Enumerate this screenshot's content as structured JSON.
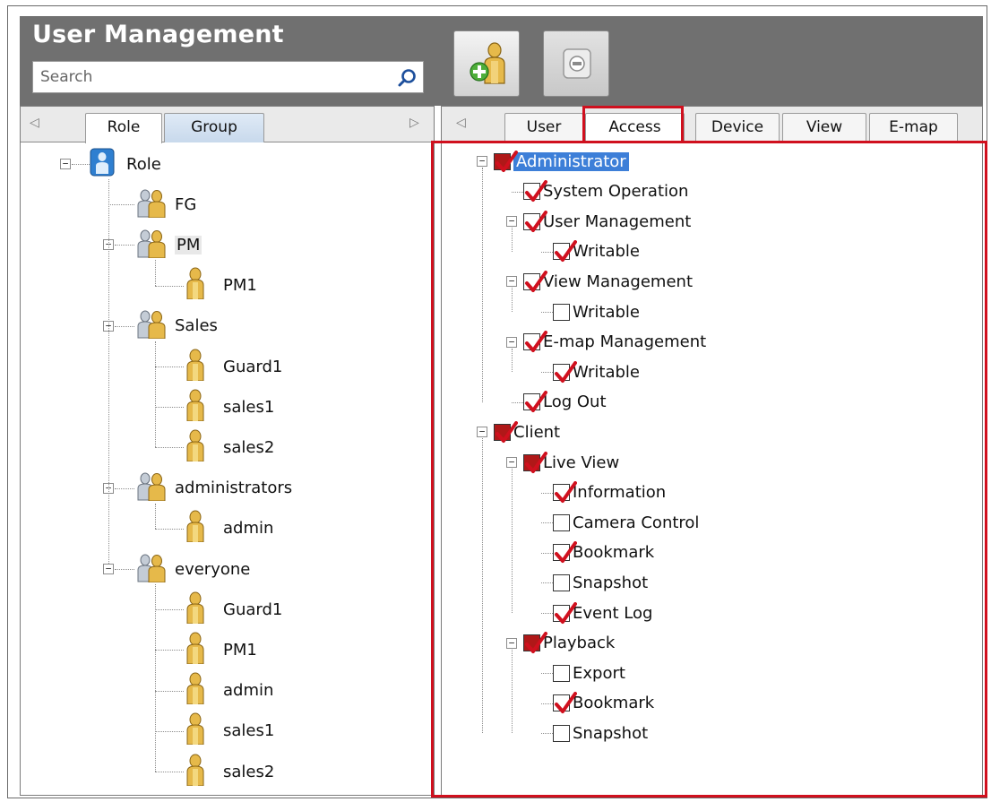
{
  "window": {
    "title": "User Management"
  },
  "search": {
    "placeholder": "Search"
  },
  "toolbar": {
    "add_icon": "add-user-icon",
    "remove_icon": "remove-user-icon"
  },
  "left_tabs": [
    {
      "label": "Role",
      "active": true
    },
    {
      "label": "Group",
      "active": false
    }
  ],
  "right_tabs": [
    {
      "label": "User",
      "active": false
    },
    {
      "label": "Access",
      "active": true
    },
    {
      "label": "Device",
      "active": false
    },
    {
      "label": "View",
      "active": false
    },
    {
      "label": "E-map",
      "active": false
    }
  ],
  "role_tree": {
    "root": "Role",
    "groups": [
      {
        "name": "FG",
        "users": []
      },
      {
        "name": "PM",
        "users": [
          "PM1"
        ]
      },
      {
        "name": "Sales",
        "users": [
          "Guard1",
          "sales1",
          "sales2"
        ]
      },
      {
        "name": "administrators",
        "users": [
          "admin"
        ]
      },
      {
        "name": "everyone",
        "users": [
          "Guard1",
          "PM1",
          "admin",
          "sales1",
          "sales2"
        ]
      }
    ]
  },
  "access_tree": [
    {
      "label": "Administrator",
      "state": "partial",
      "selected": true,
      "children": [
        {
          "label": "System Operation",
          "state": "checked"
        },
        {
          "label": "User Management",
          "state": "checked",
          "children": [
            {
              "label": "Writable",
              "state": "checked"
            }
          ]
        },
        {
          "label": "View Management",
          "state": "checked",
          "children": [
            {
              "label": "Writable",
              "state": "unchecked"
            }
          ]
        },
        {
          "label": "E-map Management",
          "state": "checked",
          "children": [
            {
              "label": "Writable",
              "state": "checked"
            }
          ]
        },
        {
          "label": "Log Out",
          "state": "checked"
        }
      ]
    },
    {
      "label": "Client",
      "state": "partial",
      "children": [
        {
          "label": "Live View",
          "state": "partial",
          "children": [
            {
              "label": "Information",
              "state": "checked"
            },
            {
              "label": "Camera Control",
              "state": "unchecked"
            },
            {
              "label": "Bookmark",
              "state": "checked"
            },
            {
              "label": "Snapshot",
              "state": "unchecked"
            },
            {
              "label": "Event Log",
              "state": "checked"
            }
          ]
        },
        {
          "label": "Playback",
          "state": "partial",
          "children": [
            {
              "label": "Export",
              "state": "unchecked"
            },
            {
              "label": "Bookmark",
              "state": "checked"
            },
            {
              "label": "Snapshot",
              "state": "unchecked"
            }
          ]
        }
      ]
    }
  ],
  "colors": {
    "header": "#707070",
    "highlight": "#d0101e",
    "check": "#d0101e",
    "selection": "#3d7fd8"
  }
}
